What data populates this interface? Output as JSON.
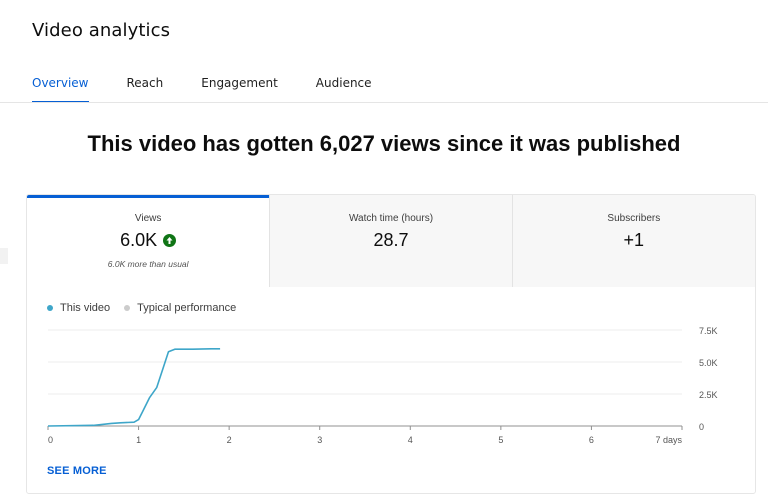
{
  "page": {
    "title": "Video analytics"
  },
  "tabs": [
    {
      "label": "Overview",
      "active": true
    },
    {
      "label": "Reach",
      "active": false
    },
    {
      "label": "Engagement",
      "active": false
    },
    {
      "label": "Audience",
      "active": false
    }
  ],
  "headline": "This video has gotten 6,027 views since it was published",
  "metrics": [
    {
      "label": "Views",
      "value": "6.0K",
      "note": "6.0K more than usual",
      "trend": "up-arrow-icon",
      "active": true
    },
    {
      "label": "Watch time (hours)",
      "value": "28.7",
      "active": false
    },
    {
      "label": "Subscribers",
      "value": "+1",
      "active": false
    }
  ],
  "legend": {
    "this_video": "This video",
    "typical": "Typical performance"
  },
  "colors": {
    "accent": "#065fd4",
    "series_this_video": "#3ea6c9",
    "series_typical": "#cccccc",
    "trend_up": "#107516"
  },
  "chart_data": {
    "type": "line",
    "series": [
      {
        "name": "This video",
        "x": [
          0,
          0.5,
          0.6,
          0.7,
          0.8,
          0.95,
          1.0,
          1.05,
          1.12,
          1.2,
          1.27,
          1.33,
          1.4,
          1.6,
          1.8,
          1.9
        ],
        "y": [
          0,
          50,
          120,
          200,
          250,
          300,
          500,
          1200,
          2200,
          3000,
          4500,
          5800,
          6000,
          6000,
          6027,
          6027
        ]
      }
    ],
    "x_ticks": [
      "0",
      "1",
      "2",
      "3",
      "4",
      "5",
      "6",
      "7 days"
    ],
    "y_ticks": [
      "0",
      "2.5K",
      "5.0K",
      "7.5K"
    ],
    "xlim": [
      0,
      7
    ],
    "ylim": [
      0,
      7500
    ],
    "grid": true
  },
  "see_more": "SEE MORE"
}
